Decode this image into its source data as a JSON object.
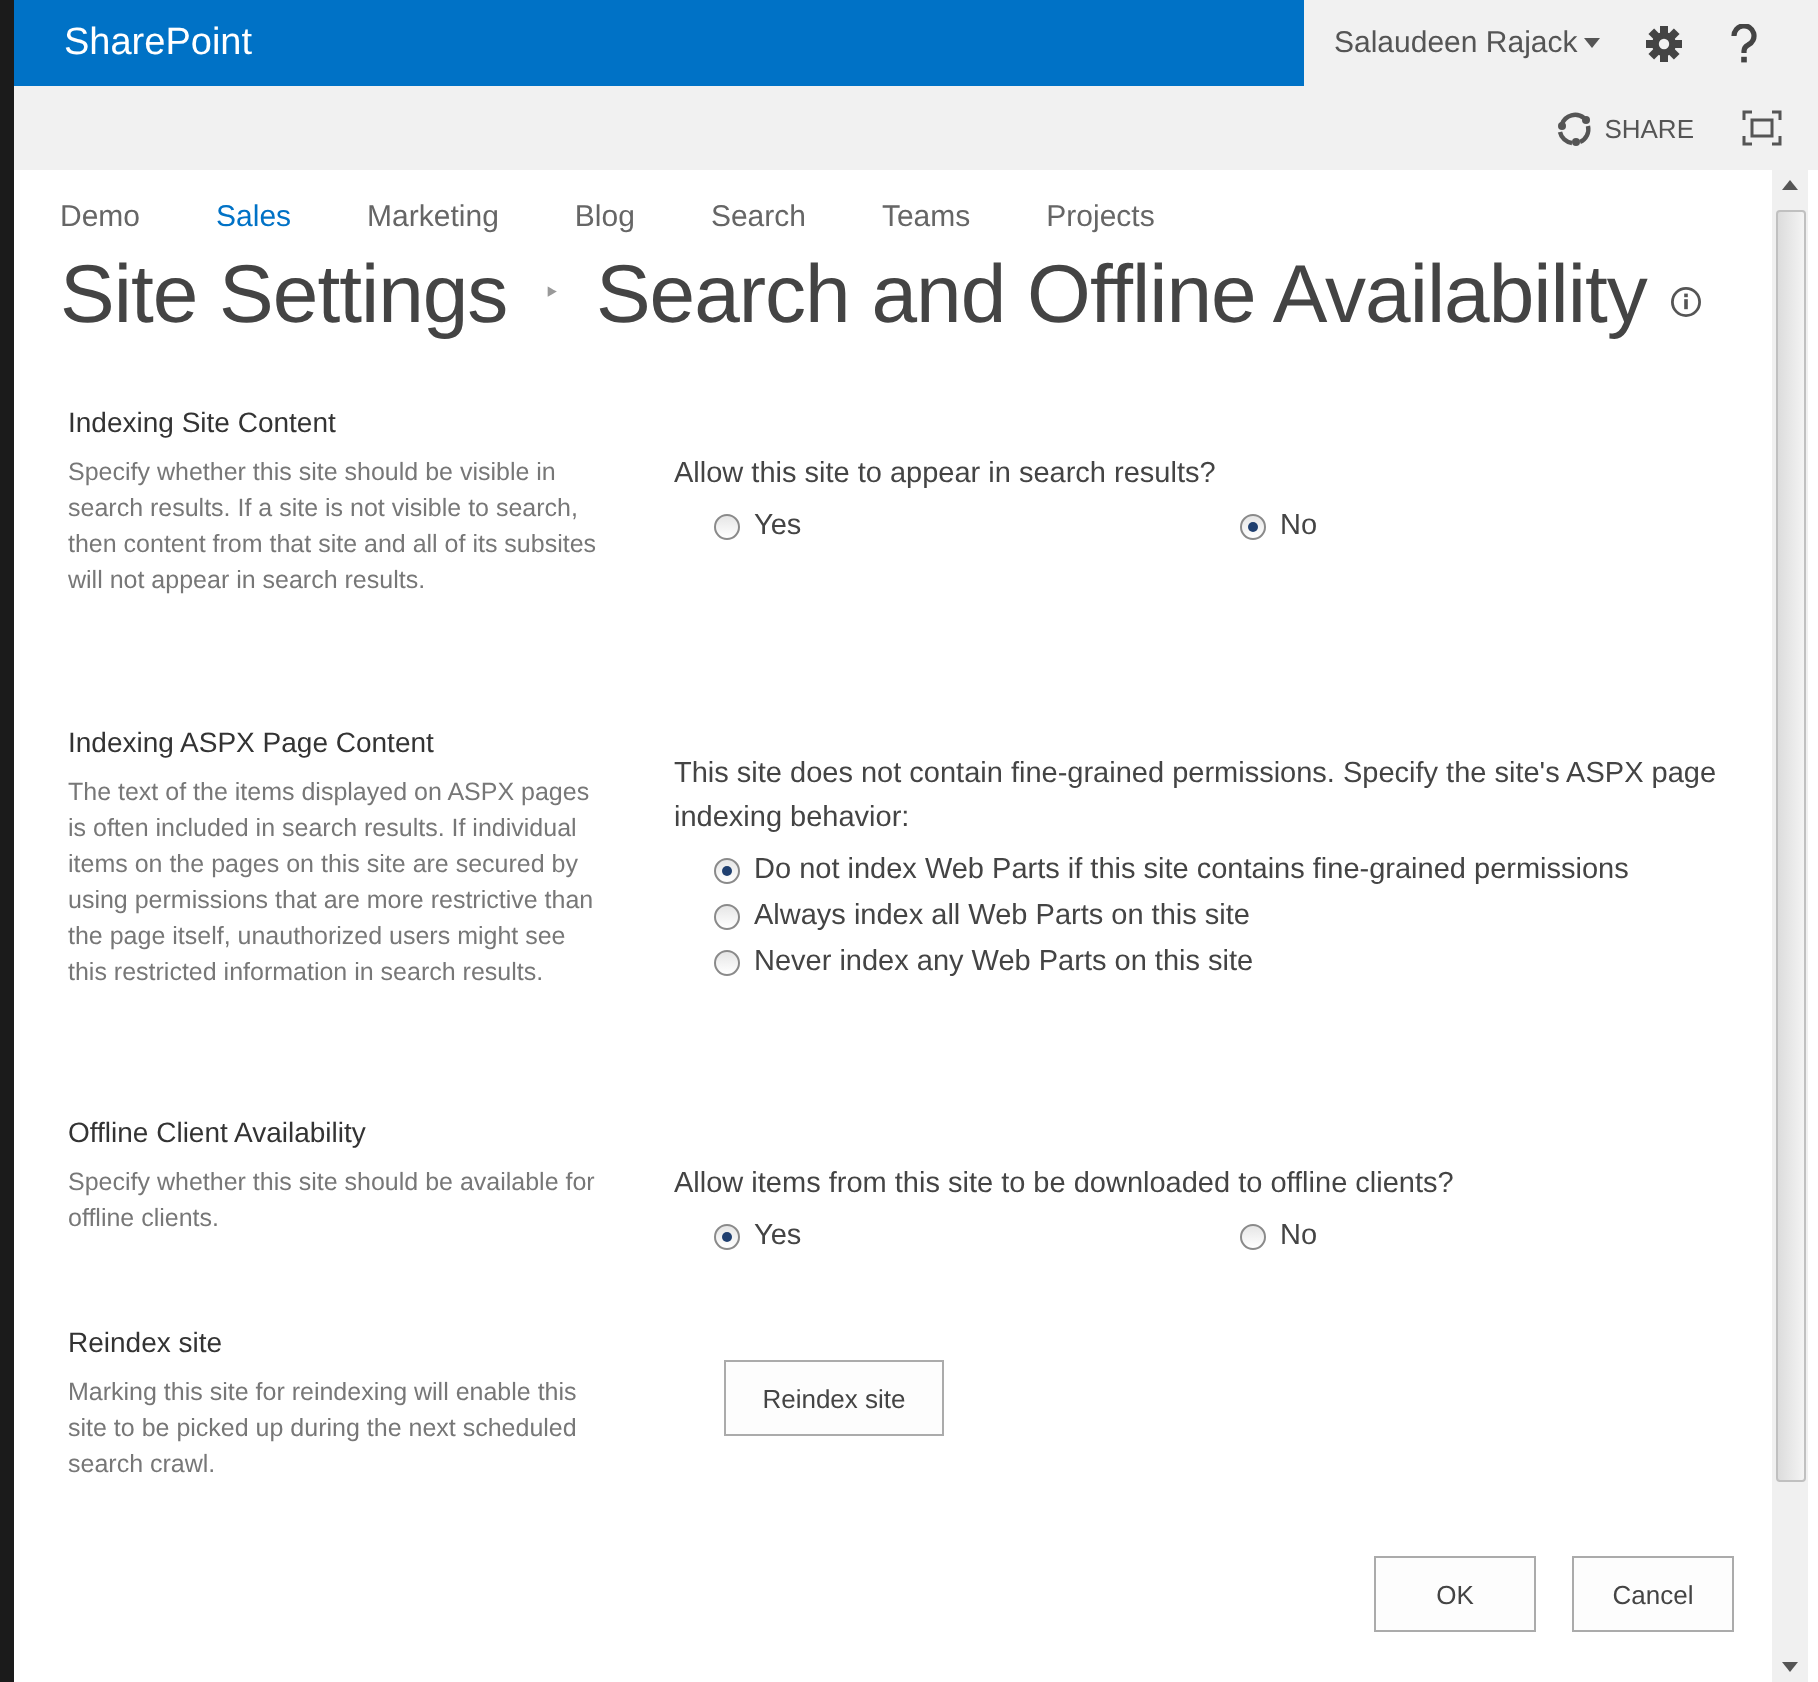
{
  "suite_bar": {
    "brand": "SharePoint",
    "user": "Salaudeen Rajack"
  },
  "ribbon": {
    "share": "SHARE"
  },
  "top_nav": [
    {
      "label": "Demo",
      "selected": false
    },
    {
      "label": "Sales",
      "selected": true
    },
    {
      "label": "Marketing",
      "selected": false
    },
    {
      "label": "Blog",
      "selected": false
    },
    {
      "label": "Search",
      "selected": false
    },
    {
      "label": "Teams",
      "selected": false
    },
    {
      "label": "Projects",
      "selected": false
    }
  ],
  "page_title": {
    "parent": "Site Settings",
    "separator": "‣",
    "title": "Search and Offline Availability"
  },
  "sections": [
    {
      "kind": "radio-row",
      "heading": "Indexing Site Content",
      "description": "Specify whether this site should be visible in search results. If a site is not visible to search, then content from that site and all of its subsites will not appear in search results.",
      "question": "Allow this site to appear in search results?",
      "options": [
        {
          "label": "Yes",
          "selected": false
        },
        {
          "label": "No",
          "selected": true
        }
      ]
    },
    {
      "kind": "radio-list",
      "heading": "Indexing ASPX Page Content",
      "description": "The text of the items displayed on ASPX pages is often included in search results. If individual items on the pages on this site are secured by using permissions that are more restrictive than the page itself, unauthorized users might see this restricted information in search results.",
      "question": "This site does not contain fine-grained permissions. Specify the site's ASPX page indexing behavior:",
      "options": [
        {
          "label": "Do not index Web Parts if this site contains fine-grained permissions",
          "selected": true
        },
        {
          "label": "Always index all Web Parts on this site",
          "selected": false
        },
        {
          "label": "Never index any Web Parts on this site",
          "selected": false
        }
      ]
    },
    {
      "kind": "radio-row",
      "heading": "Offline Client Availability",
      "description": "Specify whether this site should be available for offline clients.",
      "question": "Allow items from this site to be downloaded to offline clients?",
      "options": [
        {
          "label": "Yes",
          "selected": true
        },
        {
          "label": "No",
          "selected": false
        }
      ]
    },
    {
      "kind": "button",
      "heading": "Reindex site",
      "description": "Marking this site for reindexing will enable this site to be picked up during the next scheduled search crawl.",
      "button": "Reindex site"
    }
  ],
  "buttons": [
    "OK",
    "Cancel"
  ]
}
